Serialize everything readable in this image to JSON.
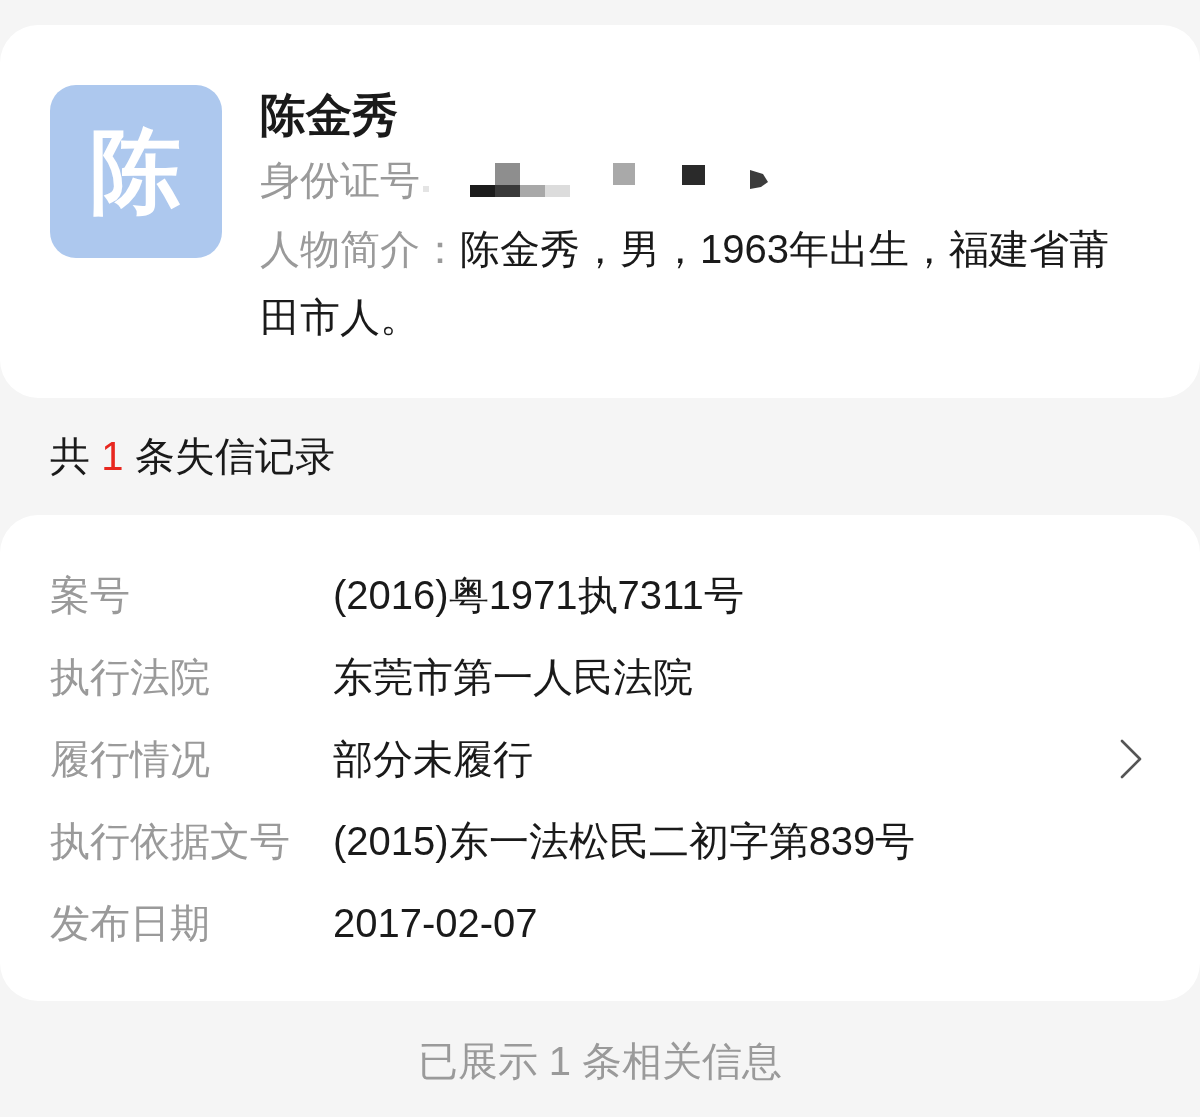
{
  "profile": {
    "avatar_text": "陈",
    "name": "陈金秀",
    "id_label": "身份证号",
    "id_redacted": true,
    "intro_label": "人物简介：",
    "intro": "陈金秀，男，1963年出生，福建省莆田市人。"
  },
  "records_heading": {
    "prefix": "共",
    "count": "1",
    "suffix": "条失信记录"
  },
  "records": [
    {
      "fields": [
        {
          "label": "案号",
          "value": "(2016)粤1971执7311号",
          "has_detail": false
        },
        {
          "label": "执行法院",
          "value": "东莞市第一人民法院",
          "has_detail": false
        },
        {
          "label": "履行情况",
          "value": "部分未履行",
          "has_detail": true
        },
        {
          "label": "执行依据文号",
          "value": "(2015)东一法松民二初字第839号",
          "has_detail": false
        },
        {
          "label": "发布日期",
          "value": "2017-02-07",
          "has_detail": false
        }
      ]
    }
  ],
  "footer": "已展示 1 条相关信息"
}
